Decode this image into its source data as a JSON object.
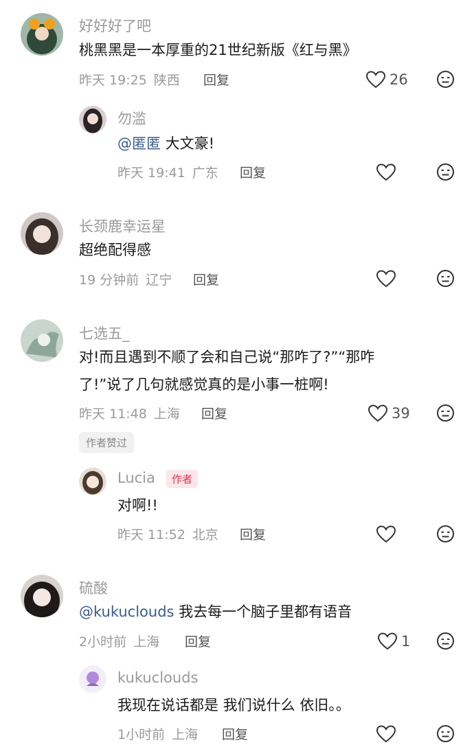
{
  "comments": [
    {
      "name": "好好好了吧",
      "text": "桃黑黑是一本厚重的21世纪新版《红与黑》",
      "time": "昨天 19:25",
      "location": "陕西",
      "reply_label": "回复",
      "likes": "26",
      "replies": [
        {
          "name": "勿滥",
          "mention": "@匿匿",
          "text": " 大文豪!",
          "time": "昨天 19:41",
          "location": "广东",
          "reply_label": "回复"
        }
      ]
    },
    {
      "name": "长颈鹿幸运星",
      "text": "超绝配得感",
      "time": "19 分钟前",
      "location": "辽宁",
      "reply_label": "回复"
    },
    {
      "name": "七选五_",
      "text_line1": "对!而且遇到不顺了会和自己说“那咋了?”“那咋",
      "text_line2": "了!”说了几句就感觉真的是小事一桩啊!",
      "time": "昨天 11:48",
      "location": "上海",
      "reply_label": "回复",
      "likes": "39",
      "badge": "作者赞过",
      "replies": [
        {
          "name": "Lucia",
          "author_tag": "作者",
          "text": "对啊!!",
          "time": "昨天 11:52",
          "location": "北京",
          "reply_label": "回复"
        }
      ]
    },
    {
      "name": "硫酸",
      "mention": "@kukuclouds",
      "text": " 我去每一个脑子里都有语音",
      "time": "2小时前",
      "location": "上海",
      "reply_label": "回复",
      "likes": "1",
      "replies": [
        {
          "name": "kukuclouds",
          "text": "我现在说话都是 我们说什么 依旧。。",
          "time": "1小时前",
          "location": "上海",
          "reply_label": "回复"
        }
      ]
    }
  ],
  "icons": {
    "like": "heart-outline-icon",
    "dislike": "neutral-face-icon"
  },
  "colors": {
    "mention": "#3a5c8e",
    "author_tag_bg": "#fde6ea",
    "author_tag_text": "#e8334f",
    "meta": "#9a9a9a"
  }
}
